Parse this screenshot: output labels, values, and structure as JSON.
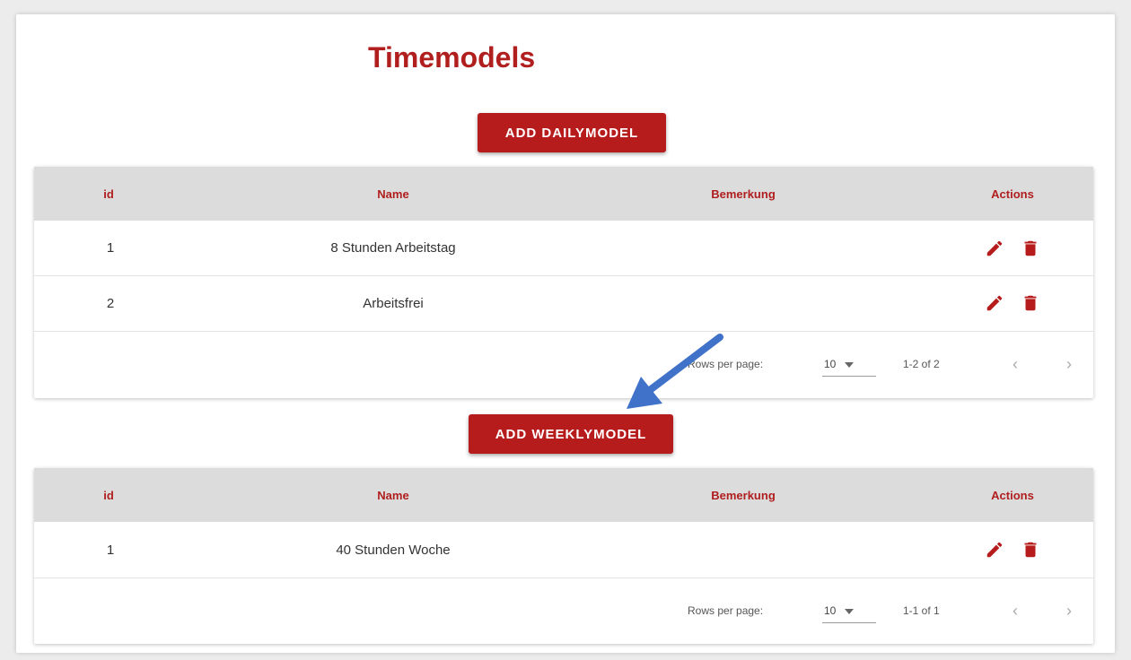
{
  "page": {
    "title": "Timemodels"
  },
  "colors": {
    "accent": "#b71c1c",
    "header_bg": "#dcdcdc",
    "arrow": "#3f72c8"
  },
  "daily": {
    "add_label": "ADD DAILYMODEL",
    "columns": {
      "id": "id",
      "name": "Name",
      "bemerkung": "Bemerkung",
      "actions": "Actions"
    },
    "rows": [
      {
        "id": "1",
        "name": "8 Stunden Arbeitstag",
        "bemerkung": ""
      },
      {
        "id": "2",
        "name": "Arbeitsfrei",
        "bemerkung": ""
      }
    ],
    "footer": {
      "rows_per_page_label": "Rows per page:",
      "rows_per_page_value": "10",
      "range": "1-2 of 2"
    }
  },
  "weekly": {
    "add_label": "ADD WEEKLYMODEL",
    "columns": {
      "id": "id",
      "name": "Name",
      "bemerkung": "Bemerkung",
      "actions": "Actions"
    },
    "rows": [
      {
        "id": "1",
        "name": "40 Stunden Woche",
        "bemerkung": ""
      }
    ],
    "footer": {
      "rows_per_page_label": "Rows per page:",
      "rows_per_page_value": "10",
      "range": "1-1 of 1"
    }
  },
  "icons": {
    "edit": "pencil-icon",
    "delete": "trash-icon",
    "dropdown": "caret-down-icon",
    "prev": "chevron-left-icon",
    "next": "chevron-right-icon",
    "annotation": "arrow-annotation"
  }
}
